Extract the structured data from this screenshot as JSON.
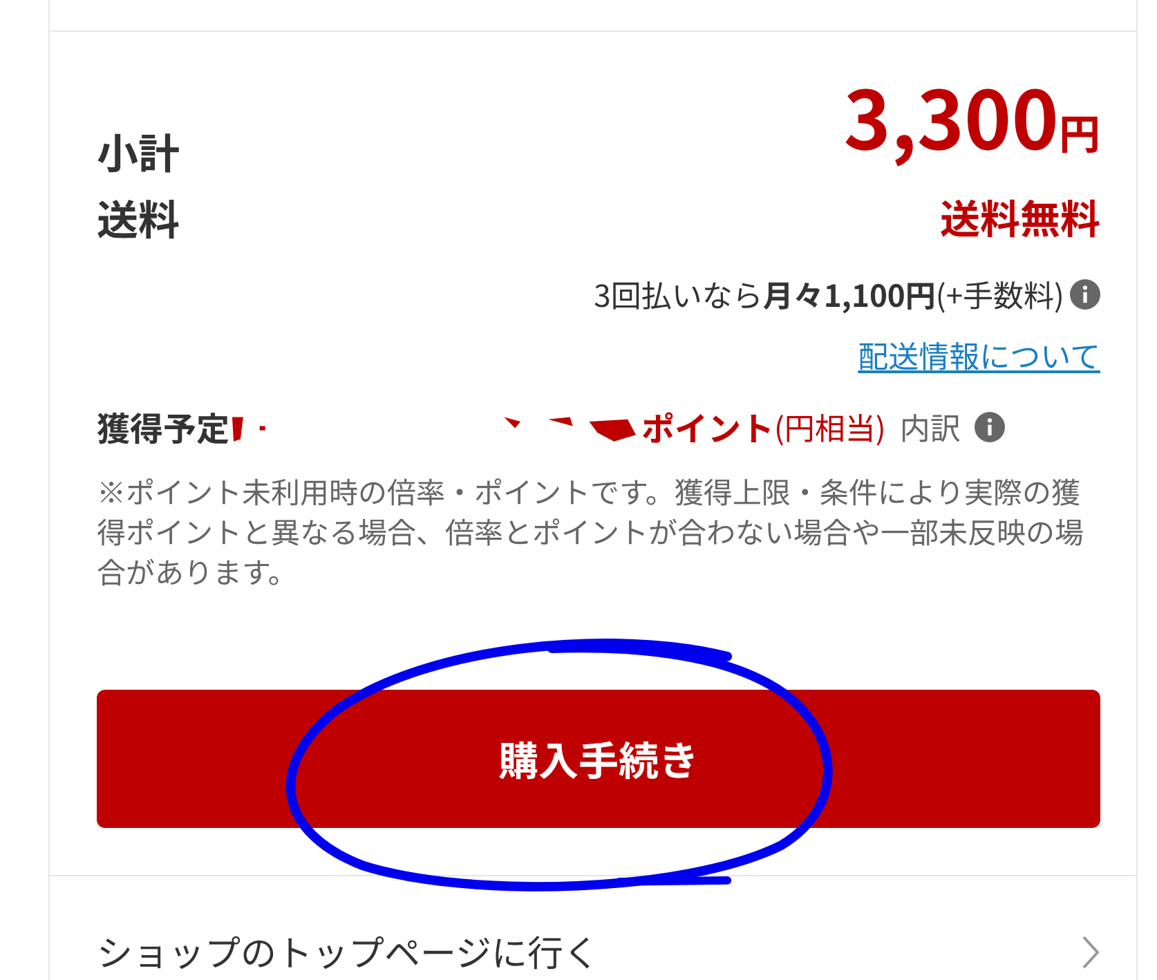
{
  "summary": {
    "subtotal": {
      "label": "小計",
      "amount": "3,300",
      "unit": "円"
    },
    "shipping": {
      "label": "送料",
      "value": "送料無料"
    },
    "installment": {
      "text": "3回払いなら**月々1,100円**(+手数料)"
    },
    "shipping_info_link": "配送情報について",
    "points": {
      "label": "獲得予定",
      "redacted": true,
      "unit": "ポイント",
      "equivalent": "(円相当)",
      "breakdown": "内訳"
    },
    "note": "※ポイント未利用時の倍率・ポイントです。獲得上限・条件により実際の獲得ポイントと異なる場合、倍率とポイントが合わない場合や一部未反映の場合があります。"
  },
  "purchase_button": "購入手続き",
  "annotation": {
    "kind": "circle"
  },
  "shop_link": "ショップのトップページに行く"
}
